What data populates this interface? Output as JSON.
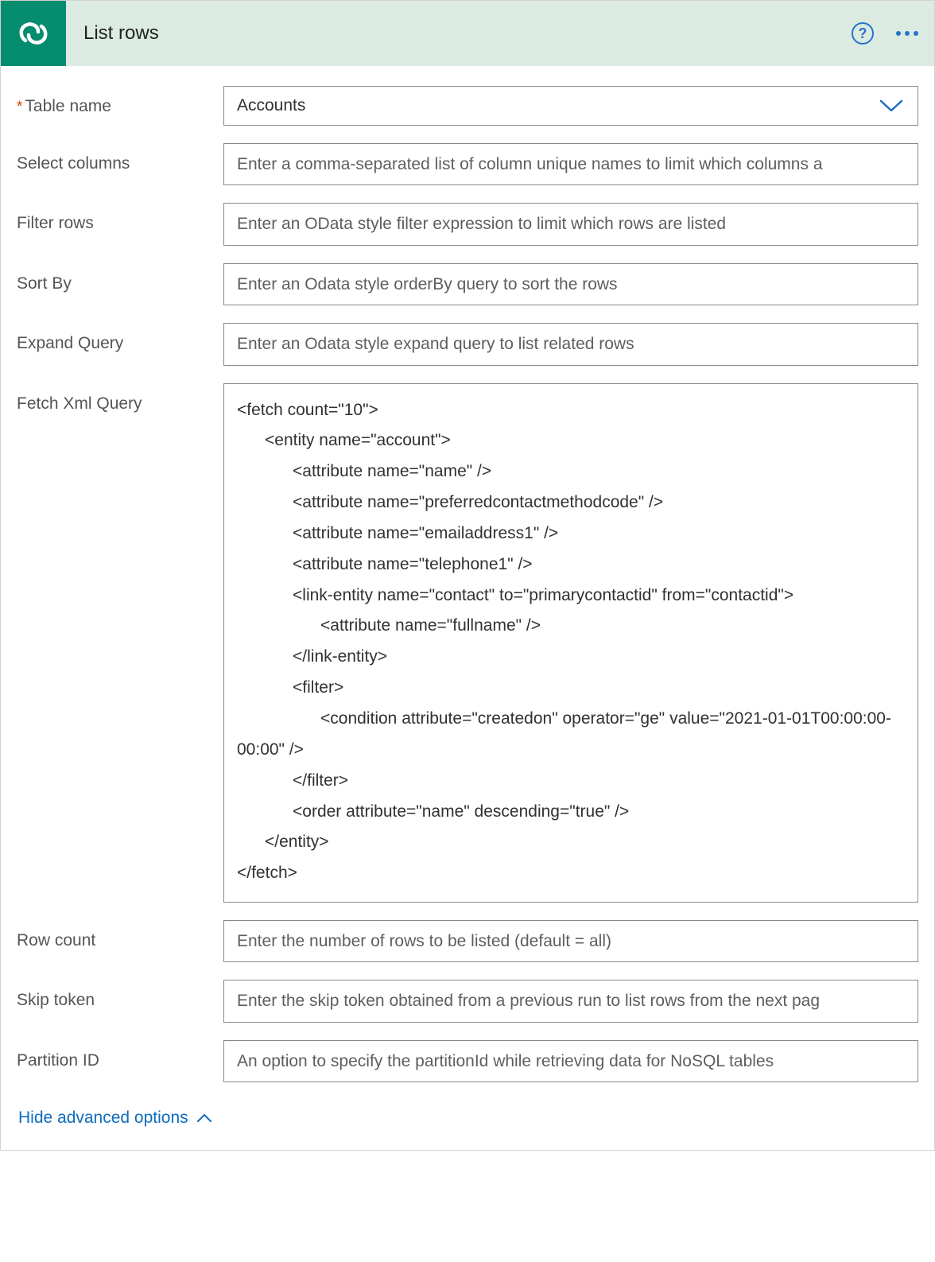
{
  "header": {
    "title": "List rows"
  },
  "fields": {
    "tableName": {
      "label": "Table name",
      "value": "Accounts"
    },
    "selectColumns": {
      "label": "Select columns",
      "placeholder": "Enter a comma-separated list of column unique names to limit which columns a"
    },
    "filterRows": {
      "label": "Filter rows",
      "placeholder": "Enter an OData style filter expression to limit which rows are listed"
    },
    "sortBy": {
      "label": "Sort By",
      "placeholder": "Enter an Odata style orderBy query to sort the rows"
    },
    "expandQuery": {
      "label": "Expand Query",
      "placeholder": "Enter an Odata style expand query to list related rows"
    },
    "fetchXmlQuery": {
      "label": "Fetch Xml Query",
      "value": "<fetch count=\"10\">\n      <entity name=\"account\">\n            <attribute name=\"name\" />\n            <attribute name=\"preferredcontactmethodcode\" />\n            <attribute name=\"emailaddress1\" />\n            <attribute name=\"telephone1\" />\n            <link-entity name=\"contact\" to=\"primarycontactid\" from=\"contactid\">\n                  <attribute name=\"fullname\" />\n            </link-entity>\n            <filter>\n                  <condition attribute=\"createdon\" operator=\"ge\" value=\"2021-01-01T00:00:00-00:00\" />\n            </filter>\n            <order attribute=\"name\" descending=\"true\" />\n      </entity>\n</fetch>"
    },
    "rowCount": {
      "label": "Row count",
      "placeholder": "Enter the number of rows to be listed (default = all)"
    },
    "skipToken": {
      "label": "Skip token",
      "placeholder": "Enter the skip token obtained from a previous run to list rows from the next pag"
    },
    "partitionId": {
      "label": "Partition ID",
      "placeholder": "An option to specify the partitionId while retrieving data for NoSQL tables"
    }
  },
  "footer": {
    "toggleLabel": "Hide advanced options"
  }
}
